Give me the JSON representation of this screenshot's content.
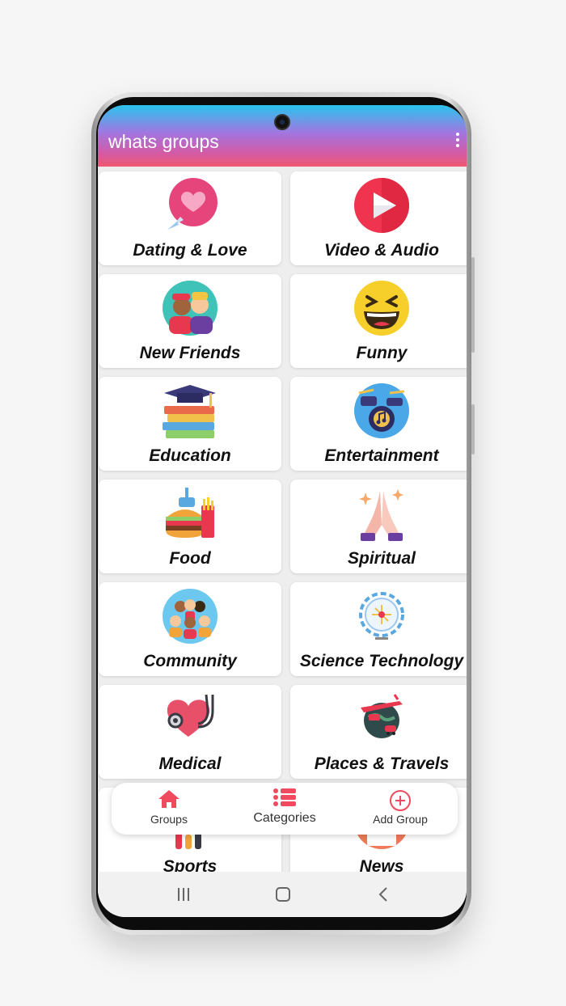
{
  "app": {
    "title": "whats groups"
  },
  "colors": {
    "accent": "#f04a5e",
    "gradient_top": "#29c4ee",
    "gradient_bottom": "#f05870"
  },
  "categories": [
    {
      "label": "Dating & Love",
      "icon": "heart-icon"
    },
    {
      "label": "Video & Audio",
      "icon": "play-icon"
    },
    {
      "label": "New Friends",
      "icon": "friends-icon"
    },
    {
      "label": "Funny",
      "icon": "laughing-face-icon"
    },
    {
      "label": "Education",
      "icon": "graduation-books-icon"
    },
    {
      "label": "Entertainment",
      "icon": "drum-music-icon"
    },
    {
      "label": "Food",
      "icon": "fast-food-icon"
    },
    {
      "label": "Spiritual",
      "icon": "praying-hands-icon"
    },
    {
      "label": "Community",
      "icon": "community-icon"
    },
    {
      "label": "Science Technology",
      "icon": "gear-tech-icon"
    },
    {
      "label": "Medical",
      "icon": "stethoscope-heart-icon"
    },
    {
      "label": "Places & Travels",
      "icon": "travel-globe-icon"
    },
    {
      "label": "Sports",
      "icon": "sports-icon"
    },
    {
      "label": "News",
      "icon": "news-icon"
    }
  ],
  "bottom_nav": {
    "groups": "Groups",
    "categories": "Categories",
    "add_group": "Add Group"
  },
  "system_nav": [
    "recents-icon",
    "home-icon",
    "back-icon"
  ]
}
